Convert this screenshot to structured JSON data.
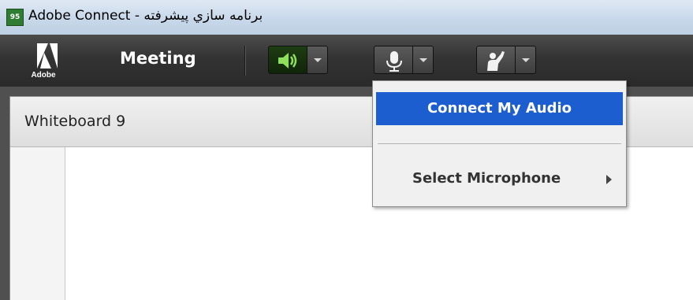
{
  "window": {
    "title": "Adobe Connect - برنامه سازي پيشرفته",
    "app_icon_text": "95"
  },
  "toolbar": {
    "logo_word": "Adobe",
    "meeting_label": "Meeting",
    "speaker_icon": "speaker-icon",
    "mic_icon": "microphone-icon",
    "raise_hand_icon": "raise-hand-icon",
    "speaker_color": "#8ee05a"
  },
  "pod": {
    "title": "Whiteboard 9"
  },
  "mic_menu": {
    "items": [
      {
        "label": "Connect My Audio",
        "highlighted": true
      },
      {
        "label": "Select Microphone",
        "has_submenu": true
      }
    ]
  },
  "colors": {
    "highlight": "#1c5ecf",
    "toolbar": "#333333"
  }
}
